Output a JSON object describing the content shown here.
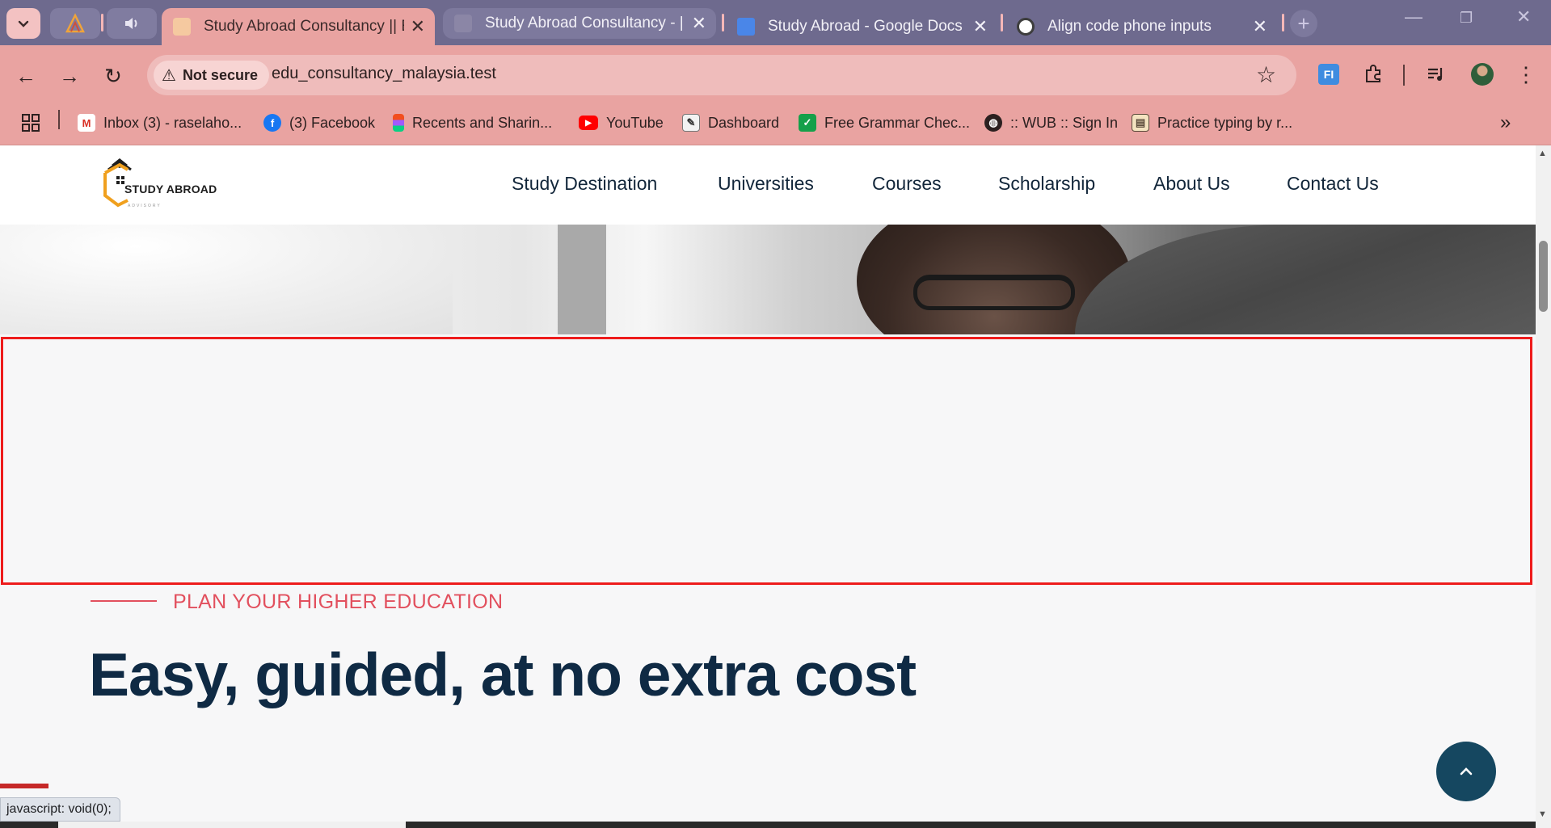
{
  "browser": {
    "tabs": [
      {
        "title": "Study Abroad Consultancy || Ed",
        "active": true
      },
      {
        "title": "Study Abroad Consultancy - | C",
        "active": false
      },
      {
        "title": "Study Abroad - Google Docs",
        "active": false
      },
      {
        "title": "Align code phone inputs",
        "active": false
      }
    ],
    "security_label": "Not secure",
    "url": "edu_consultancy_malaysia.test",
    "bookmarks": [
      {
        "label": "Inbox (3) - raselaho..."
      },
      {
        "label": "(3) Facebook"
      },
      {
        "label": "Recents and Sharin..."
      },
      {
        "label": "YouTube"
      },
      {
        "label": "Dashboard"
      },
      {
        "label": "Free Grammar Chec..."
      },
      {
        "label": ":: WUB :: Sign In"
      },
      {
        "label": "Practice typing by r..."
      }
    ],
    "extension_label": "FI",
    "status_text": "javascript: void(0);",
    "colors": {
      "tabstrip": "#6e6a8e",
      "toolbar": "#e9a3a1"
    }
  },
  "site": {
    "logo_text": "STUDY ABROAD",
    "logo_subtext": "ADVISORY",
    "nav": [
      "Study Destination",
      "Universities",
      "Courses",
      "Scholarship",
      "About Us",
      "Contact Us"
    ],
    "eyebrow": "PLAN YOUR HIGHER EDUCATION",
    "headline": "Easy, guided, at no extra cost",
    "colors": {
      "accent": "#e2505e",
      "heading": "#0f2a44",
      "highlight_border": "#ee1c1c",
      "scroll_top_button": "#154760"
    }
  }
}
